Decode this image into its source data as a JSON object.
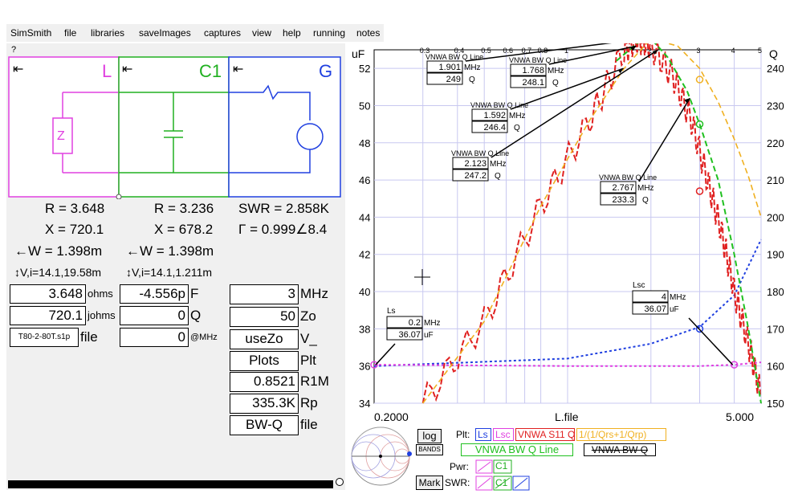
{
  "menu": [
    {
      "label": "SimSmith",
      "name": "menu-simsmith"
    },
    {
      "label": "file",
      "name": "menu-file"
    },
    {
      "label": "libraries",
      "name": "menu-libraries"
    },
    {
      "label": "saveImages",
      "name": "menu-saveimages"
    },
    {
      "label": "captures",
      "name": "menu-captures"
    },
    {
      "label": "view",
      "name": "menu-view"
    },
    {
      "label": "help",
      "name": "menu-help"
    },
    {
      "label": "running",
      "name": "menu-running"
    },
    {
      "label": "notes",
      "name": "menu-notes"
    }
  ],
  "help_mark": "?",
  "components": {
    "L": {
      "title": "L",
      "color": "#e040e0"
    },
    "C1": {
      "title": "C1",
      "color": "#20b020"
    },
    "G": {
      "title": "G",
      "color": "#2040e0"
    },
    "arrow_glyph": "⇤",
    "z_label": "Z"
  },
  "readouts": {
    "col1": {
      "r": "R = 3.648",
      "x": "X = 720.1",
      "w": "←W = 1.398m",
      "vi": "↕V,i=14.1,19.58m"
    },
    "col2": {
      "r": "R = 3.236",
      "x": "X = 678.2",
      "w": "←W = 1.398m",
      "vi": "↕V,i=14.1,1.211m"
    },
    "col3": {
      "swr": "SWR = 2.858K",
      "gamma": "Γ = 0.999∠8.4"
    }
  },
  "L_fields": {
    "ohms_value": "3.648",
    "ohms_unit": "ohms",
    "johms_value": "720.1",
    "johms_unit": "johms",
    "file_value": "T80-2-80T.s1p",
    "file_unit": "file"
  },
  "C1_fields": {
    "f_value": "-4.556p",
    "f_unit": "F",
    "q_value": "0",
    "q_unit": "Q",
    "mhz_value": "0",
    "mhz_unit": "@MHz"
  },
  "G_fields": {
    "mhz_value": "3",
    "mhz_unit": "MHz",
    "zo_value": "50",
    "zo_unit": "Zo",
    "usezo_value": "useZo",
    "usezo_unit": "V_",
    "plots_value": "Plots",
    "plots_unit": "Plt",
    "r1m_value": "0.8521",
    "r1m_unit": "R1M",
    "rp_value": "335.3K",
    "rp_unit": "Rp",
    "bwq_value": "BW-Q",
    "bwq_unit": "file"
  },
  "chart_axes": {
    "left_unit": "uF",
    "right_unit": "Q",
    "x_left": "0.2000",
    "x_center": "L.file",
    "x_right": "5.000",
    "top_ticks": [
      "0.3",
      "0.4",
      "0.5",
      "0.6",
      "0.7",
      "0.8",
      "1",
      "2",
      "3",
      "4",
      "5"
    ],
    "left_ticks": [
      "52",
      "50",
      "48",
      "46",
      "44",
      "42",
      "40",
      "38",
      "36",
      "34"
    ],
    "right_ticks": [
      "240",
      "230",
      "220",
      "210",
      "200",
      "190",
      "180",
      "170",
      "160",
      "150"
    ]
  },
  "chart_data": {
    "type": "line",
    "x_scale": "log",
    "xlim": [
      0.2,
      5.0
    ],
    "xlabel": "L.file",
    "ylim_left": [
      34,
      53
    ],
    "ylim_right": [
      150,
      245
    ],
    "ylabel_left": "uF",
    "ylabel_right": "Q",
    "series": [
      {
        "name": "Ls",
        "color": "#2040e0",
        "axis": "left",
        "x": [
          0.2,
          1,
          2,
          3,
          4,
          5
        ],
        "values": [
          36,
          36.4,
          37.2,
          38.1,
          39.8,
          42.8
        ]
      },
      {
        "name": "Lsc",
        "color": "#e040e0",
        "axis": "left",
        "x": [
          0.2,
          1,
          2,
          3,
          4,
          5
        ],
        "values": [
          36.07,
          36.0,
          36.0,
          36.0,
          36.07,
          36.2
        ]
      },
      {
        "name": "VNWA S11 Q",
        "color": "#e02020",
        "axis": "right",
        "x": [
          0.3,
          0.5,
          0.8,
          1.2,
          1.6,
          1.8,
          2.0,
          2.4,
          2.8,
          3.2,
          3.6,
          4.0,
          4.5,
          5.0
        ],
        "values": [
          150,
          172,
          203,
          226,
          245,
          248,
          246,
          238,
          226,
          210,
          196,
          180,
          166,
          152
        ]
      },
      {
        "name": "1/(1/Qrs+1/Qrp)",
        "color": "#f0b020",
        "axis": "right",
        "x": [
          0.3,
          0.5,
          0.8,
          1.2,
          1.6,
          2.0,
          2.5,
          3.0,
          3.5,
          4.0,
          4.5,
          5.0
        ],
        "values": [
          150,
          172,
          203,
          226,
          240,
          248,
          246,
          240,
          231,
          221,
          211,
          200
        ]
      },
      {
        "name": "VNWA BW Q Line",
        "color": "#20c020",
        "axis": "right",
        "x": [
          1.5,
          1.8,
          2.0,
          2.3,
          2.7,
          3.0,
          3.5,
          4.0,
          4.5,
          5.0
        ],
        "values": [
          242,
          247,
          248,
          243,
          234,
          225,
          210,
          190,
          170,
          150
        ]
      }
    ],
    "markers": [
      {
        "mhz": "1.901",
        "q": "249",
        "label": "VNWA BW Q Line"
      },
      {
        "mhz": "1.768",
        "q": "248.1",
        "label": "VNWA BW Q Line"
      },
      {
        "mhz": "1.592",
        "q": "246.4",
        "label": "VNWA BW Q Line"
      },
      {
        "mhz": "2.123",
        "q": "247.2",
        "label": "VNWA BW Q Line"
      },
      {
        "mhz": "2.767",
        "q": "233.3",
        "label": "VNWA BW Q Line"
      }
    ],
    "point_labels": [
      {
        "name": "Ls",
        "mhz": "0.2",
        "uf": "36.07"
      },
      {
        "name": "Lsc",
        "mhz": "4",
        "uf": "36.07"
      }
    ],
    "marker_unit_mhz": "MHz",
    "marker_unit_q": "Q",
    "marker_unit_uf": "uF"
  },
  "legend": {
    "plt_label": "Plt:",
    "items": [
      {
        "label": "Ls",
        "color": "#2040e0"
      },
      {
        "label": "Lsc",
        "color": "#e040e0"
      },
      {
        "label": "VNWA S11 Q",
        "color": "#e02020"
      },
      {
        "label": "1/(1/Qrs+1/Qrp)",
        "color": "#f0b020"
      }
    ],
    "bwq_line": "VNWA BW Q Line",
    "bwq": "VNWA BW Q",
    "pwr_label": "Pwr:",
    "swr_label": "SWR:",
    "c1": "C1"
  },
  "buttons": {
    "log": "log",
    "bands": "BANDS",
    "mark": "Mark"
  }
}
